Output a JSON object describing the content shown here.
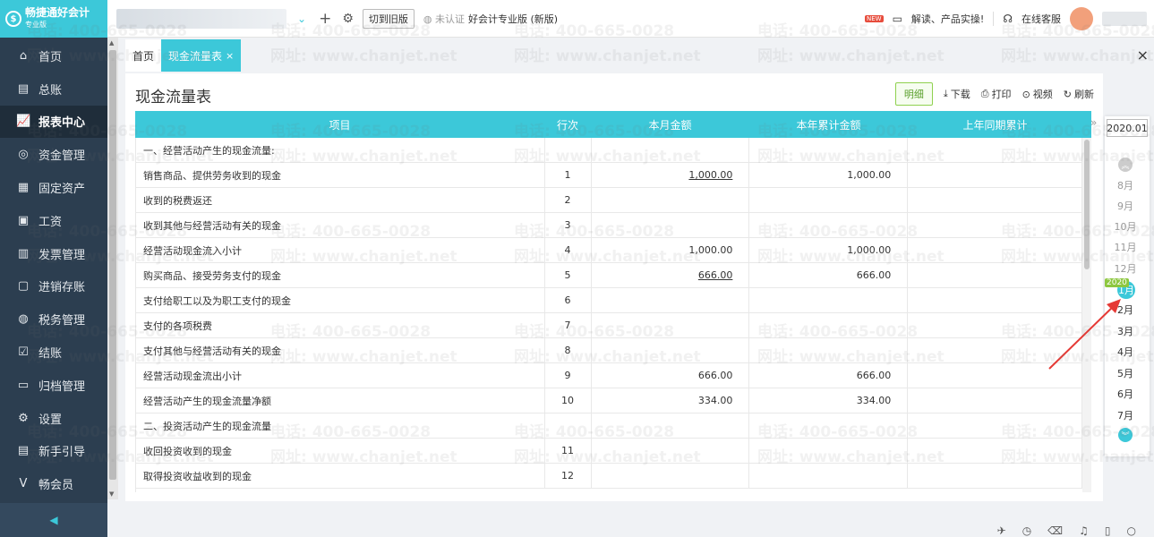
{
  "app": {
    "logo_name": "畅捷通好会计",
    "logo_sub": "专业版"
  },
  "sidebar": {
    "items": [
      {
        "label": "首页",
        "icon": "⌂"
      },
      {
        "label": "总账",
        "icon": "▤"
      },
      {
        "label": "报表中心",
        "icon": "📈"
      },
      {
        "label": "资金管理",
        "icon": "◎"
      },
      {
        "label": "固定资产",
        "icon": "▦"
      },
      {
        "label": "工资",
        "icon": "▣"
      },
      {
        "label": "发票管理",
        "icon": "▥"
      },
      {
        "label": "进销存账",
        "icon": "▢"
      },
      {
        "label": "税务管理",
        "icon": "◍"
      },
      {
        "label": "结账",
        "icon": "☑"
      },
      {
        "label": "归档管理",
        "icon": "▭"
      },
      {
        "label": "设置",
        "icon": "⚙"
      },
      {
        "label": "新手引导",
        "icon": "▤"
      },
      {
        "label": "畅会员",
        "icon": "V"
      }
    ],
    "active_index": 2,
    "collapse_icon": "◀"
  },
  "topbar": {
    "switch_old": "切到旧版",
    "cert": "未认证",
    "product": "好会计专业版 (新版)",
    "new_badge": "NEW",
    "news": "解读、产品实操!",
    "service": "在线客服"
  },
  "tabs": [
    {
      "label": "首页",
      "active": false
    },
    {
      "label": "现金流量表",
      "active": true,
      "close": "×"
    }
  ],
  "tabs_close": "×",
  "page": {
    "title": "现金流量表",
    "tools": {
      "detail": "明细",
      "download": "下载",
      "print": "打印",
      "video": "视频",
      "refresh": "刷新"
    }
  },
  "table": {
    "headers": {
      "item": "项目",
      "line": "行次",
      "month": "本月金额",
      "year": "本年累计金额",
      "last": "上年同期累计"
    },
    "rows": [
      {
        "item": "一、经营活动产生的现金流量:",
        "line": "",
        "month": "",
        "year": "",
        "link": false
      },
      {
        "item": "销售商品、提供劳务收到的现金",
        "line": "1",
        "month": "1,000.00",
        "year": "1,000.00",
        "link": true
      },
      {
        "item": "收到的税费返还",
        "line": "2",
        "month": "",
        "year": "",
        "link": false
      },
      {
        "item": "收到其他与经营活动有关的现金",
        "line": "3",
        "month": "",
        "year": "",
        "link": false
      },
      {
        "item": "经营活动现金流入小计",
        "line": "4",
        "month": "1,000.00",
        "year": "1,000.00",
        "link": false
      },
      {
        "item": "购买商品、接受劳务支付的现金",
        "line": "5",
        "month": "666.00",
        "year": "666.00",
        "link": true
      },
      {
        "item": "支付给职工以及为职工支付的现金",
        "line": "6",
        "month": "",
        "year": "",
        "link": false
      },
      {
        "item": "支付的各项税费",
        "line": "7",
        "month": "",
        "year": "",
        "link": false
      },
      {
        "item": "支付其他与经营活动有关的现金",
        "line": "8",
        "month": "",
        "year": "",
        "link": false
      },
      {
        "item": "经营活动现金流出小计",
        "line": "9",
        "month": "666.00",
        "year": "666.00",
        "link": false
      },
      {
        "item": "经营活动产生的现金流量净额",
        "line": "10",
        "month": "334.00",
        "year": "334.00",
        "link": false
      },
      {
        "item": "二、投资活动产生的现金流量",
        "line": "",
        "month": "",
        "year": "",
        "link": false
      },
      {
        "item": "收回投资收到的现金",
        "line": "11",
        "month": "",
        "year": "",
        "link": false
      },
      {
        "item": "取得投资收益收到的现金",
        "line": "12",
        "month": "",
        "year": "",
        "link": false
      }
    ]
  },
  "picker": {
    "year_value": "2020.01",
    "year_badge": "2020",
    "months": [
      "8月",
      "9月",
      "10月",
      "11月",
      "12月",
      "1月",
      "2月",
      "3月",
      "4月",
      "5月",
      "6月",
      "7月"
    ],
    "selected_index": 5
  },
  "watermark": {
    "phone": "电话: 400-665-0028",
    "site": "网址: www.chanjet.net"
  },
  "colors": {
    "accent": "#3cc8d9",
    "sidebar": "#2c3e50",
    "detail_green": "#8fd14f",
    "annotation_red": "#e53935"
  }
}
